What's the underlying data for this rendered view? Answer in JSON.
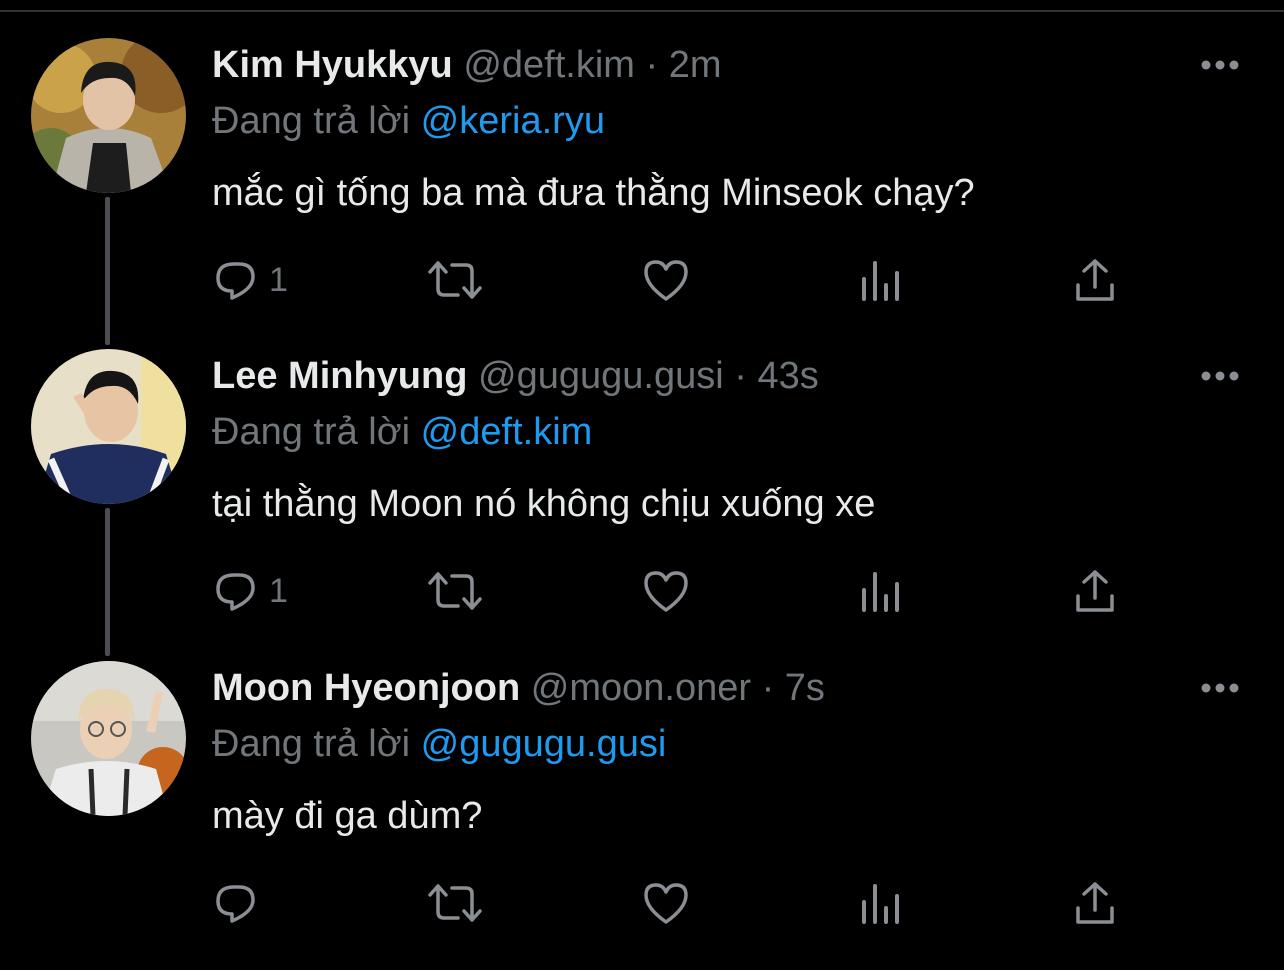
{
  "reply_prefix": "Đang trả lời",
  "tweets": [
    {
      "name": "Kim Hyukkyu",
      "handle": "@deft.kim",
      "separator": "·",
      "time": "2m",
      "reply_to": "@keria.ryu",
      "text": "mắc gì tống ba mà đưa thằng Minseok chạy?",
      "reply_count": "1",
      "avatar_icon": "profile-photo"
    },
    {
      "name": "Lee Minhyung",
      "handle": "@gugugu.gusi",
      "separator": "·",
      "time": "43s",
      "reply_to": "@deft.kim",
      "text": "tại thằng Moon nó không chịu xuống xe",
      "reply_count": "1",
      "avatar_icon": "profile-photo"
    },
    {
      "name": "Moon Hyeonjoon",
      "handle": "@moon.oner",
      "separator": "·",
      "time": "7s",
      "reply_to": "@gugugu.gusi",
      "text": "mày đi ga dùm?",
      "reply_count": "",
      "avatar_icon": "profile-photo"
    }
  ],
  "colors": {
    "background": "#000000",
    "text": "#e7e9ea",
    "muted": "#71767b",
    "mention": "#1d9bf0"
  }
}
